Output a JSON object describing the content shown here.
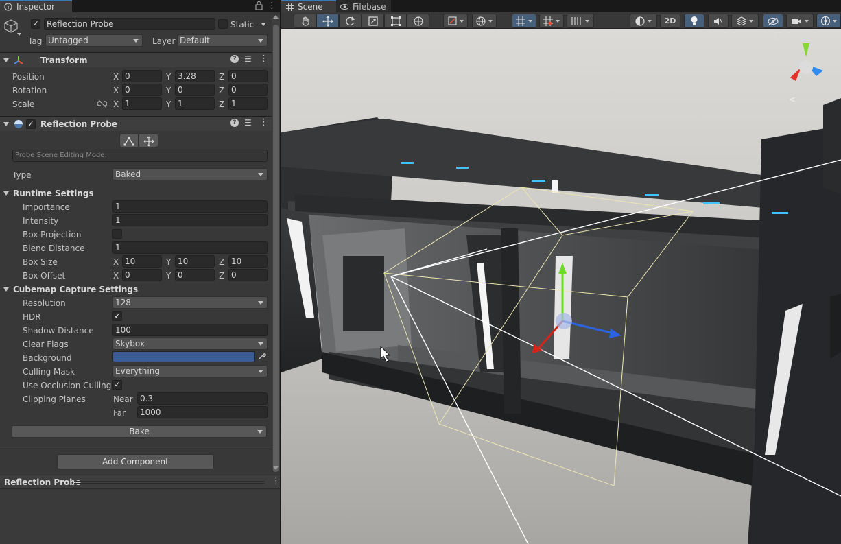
{
  "inspector": {
    "tab_label": "Inspector",
    "object_name": "Reflection Probe",
    "static_label": "Static",
    "tag_label": "Tag",
    "tag_value": "Untagged",
    "layer_label": "Layer",
    "layer_value": "Default",
    "transform": {
      "title": "Transform",
      "position_label": "Position",
      "position": {
        "x": "0",
        "y": "3.28",
        "z": "0"
      },
      "rotation_label": "Rotation",
      "rotation": {
        "x": "0",
        "y": "0",
        "z": "0"
      },
      "scale_label": "Scale",
      "scale": {
        "x": "1",
        "y": "1",
        "z": "1"
      }
    },
    "probe": {
      "title": "Reflection Probe",
      "editing_mode": "Probe Scene Editing Mode:",
      "type_label": "Type",
      "type_value": "Baked",
      "runtime": {
        "title": "Runtime Settings",
        "importance_label": "Importance",
        "importance": "1",
        "intensity_label": "Intensity",
        "intensity": "1",
        "box_projection_label": "Box Projection",
        "blend_distance_label": "Blend Distance",
        "blend_distance": "1",
        "box_size_label": "Box Size",
        "box_size": {
          "x": "10",
          "y": "10",
          "z": "10"
        },
        "box_offset_label": "Box Offset",
        "box_offset": {
          "x": "0",
          "y": "0",
          "z": "0"
        }
      },
      "cubemap": {
        "title": "Cubemap Capture Settings",
        "resolution_label": "Resolution",
        "resolution": "128",
        "hdr_label": "HDR",
        "shadow_distance_label": "Shadow Distance",
        "shadow_distance": "100",
        "clear_flags_label": "Clear Flags",
        "clear_flags": "Skybox",
        "background_label": "Background",
        "background_color": "#3b5c96",
        "culling_mask_label": "Culling Mask",
        "culling_mask": "Everything",
        "occlusion_label": "Use Occlusion Culling",
        "clipping_label": "Clipping Planes",
        "near_label": "Near",
        "near": "0.3",
        "far_label": "Far",
        "far": "1000"
      },
      "bake_label": "Bake"
    },
    "add_component_label": "Add Component",
    "preview_title": "Reflection Probe",
    "axis": {
      "x": "X",
      "y": "Y",
      "z": "Z"
    },
    "check_mark": "✓"
  },
  "scene": {
    "tabs": [
      "Scene",
      "Filebase"
    ],
    "toolbar": {
      "mode_2d": "2D"
    }
  }
}
